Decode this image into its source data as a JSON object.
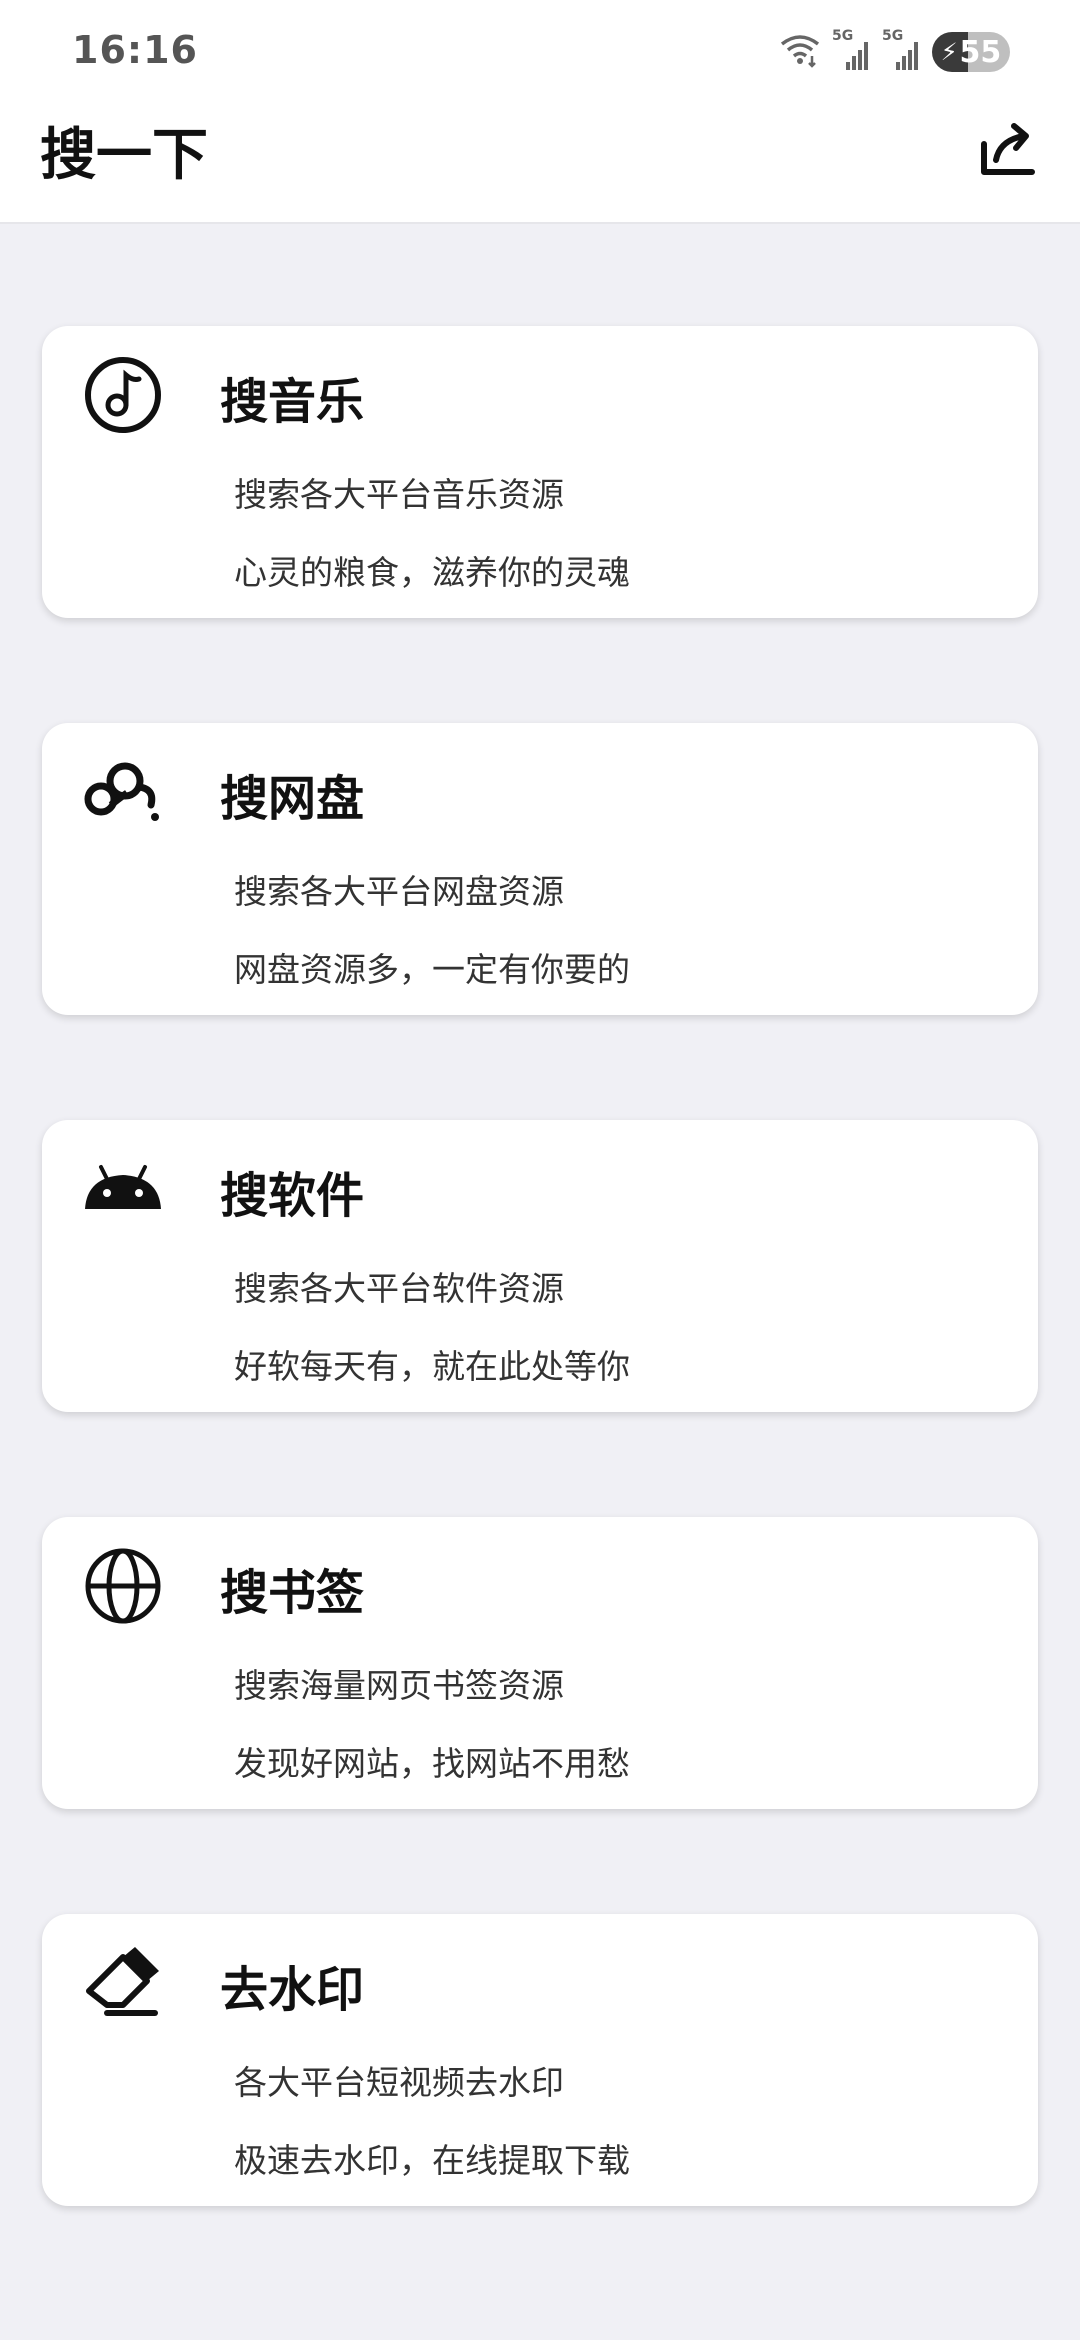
{
  "status_bar": {
    "time": "16:16",
    "wifi_icon": "wifi-6-icon",
    "signal_1_label": "5G",
    "signal_2_label": "5G",
    "battery_level": "55",
    "charging_icon": "bolt-icon"
  },
  "app_bar": {
    "title": "搜一下",
    "share_icon": "share-icon"
  },
  "cards": [
    {
      "icon": "music-note-icon",
      "title": "搜音乐",
      "line1": "搜索各大平台音乐资源",
      "line2": "心灵的粮食，滋养你的灵魂"
    },
    {
      "icon": "cloud-drive-icon",
      "title": "搜网盘",
      "line1": "搜索各大平台网盘资源",
      "line2": "网盘资源多，一定有你要的"
    },
    {
      "icon": "android-icon",
      "title": "搜软件",
      "line1": "搜索各大平台软件资源",
      "line2": "好软每天有，就在此处等你"
    },
    {
      "icon": "globe-icon",
      "title": "搜书签",
      "line1": "搜索海量网页书签资源",
      "line2": "发现好网站，找网站不用愁"
    },
    {
      "icon": "eraser-icon",
      "title": "去水印",
      "line1": "各大平台短视频去水印",
      "line2": "极速去水印，在线提取下载"
    }
  ],
  "colors": {
    "background": "#f0f0f5",
    "card": "#ffffff",
    "text": "#111111"
  }
}
